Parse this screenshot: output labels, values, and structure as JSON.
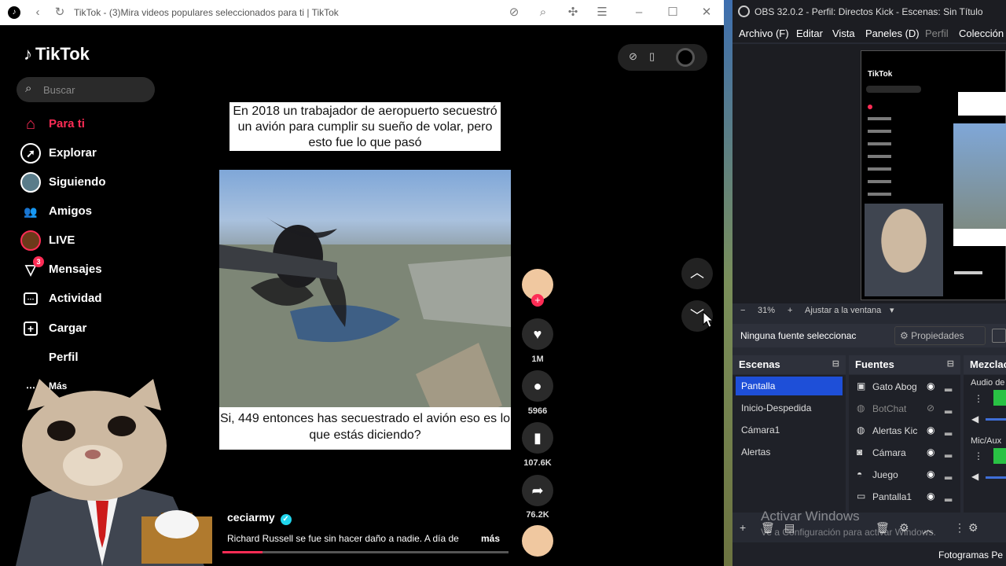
{
  "browser": {
    "title": "TikTok - (3)Mira videos populares seleccionados para ti | TikTok"
  },
  "tiktok": {
    "logo": "TikTok",
    "search_placeholder": "Buscar",
    "nav": [
      {
        "label": "Para ti",
        "icon": "home-icon",
        "color": "#fe2c55"
      },
      {
        "label": "Explorar",
        "icon": "compass-icon"
      },
      {
        "label": "Siguiendo",
        "icon": "avatar-icon"
      },
      {
        "label": "Amigos",
        "icon": "friends-icon"
      },
      {
        "label": "LIVE",
        "icon": "live-icon"
      },
      {
        "label": "Mensajes",
        "icon": "inbox-icon",
        "badge": "3"
      },
      {
        "label": "Actividad",
        "icon": "activity-icon"
      },
      {
        "label": "Cargar",
        "icon": "upload-icon"
      },
      {
        "label": "Perfil",
        "icon": "profile-icon"
      },
      {
        "label": "Más",
        "icon": "more-icon"
      }
    ],
    "video": {
      "caption_top": "En 2018 un trabajador de aeropuerto secuestró un avión para cumplir su sueño de volar, pero esto fue lo que pasó",
      "caption_bottom": "Si, 449 entonces has secuestrado el avión eso es lo que estás diciendo?",
      "author": "ceciarmy",
      "description": "Richard Russell se fue sin hacer daño a nadie. A día de",
      "more": "más",
      "progress": 0.14
    },
    "actions": {
      "likes": "1M",
      "comments": "5966",
      "saves": "107.6K",
      "shares": "76.2K"
    }
  },
  "obs": {
    "title": "OBS 32.0.2 - Perfil: Directos Kick - Escenas: Sin Título",
    "menu": [
      "Archivo (F)",
      "Editar",
      "Vista",
      "Paneles (D)",
      "Perfil",
      "Colección"
    ],
    "zoom": "31%",
    "fit": "Ajustar a la ventana",
    "no_source": "Ninguna fuente seleccionac",
    "properties": "Propiedades",
    "scenes_header": "Escenas",
    "sources_header": "Fuentes",
    "mixer_header": "Mezclac",
    "scenes": [
      "Pantalla",
      "Inicio-Despedida",
      "Cámara1",
      "Alertas"
    ],
    "sources": [
      "Gato Abog",
      "BotChat",
      "Alertas Kic",
      "Cámara",
      "Juego",
      "Pantalla1"
    ],
    "mixer": [
      "Audio de",
      "Mic/Aux"
    ],
    "activate_title": "Activar Windows",
    "activate_sub": "Ve a Configuración para activar Windows.",
    "footer": "Fotogramas Pe"
  },
  "colors": {
    "accent": "#fe2c55",
    "obs_selected": "#1e4fd8",
    "verified": "#20d5ec"
  }
}
